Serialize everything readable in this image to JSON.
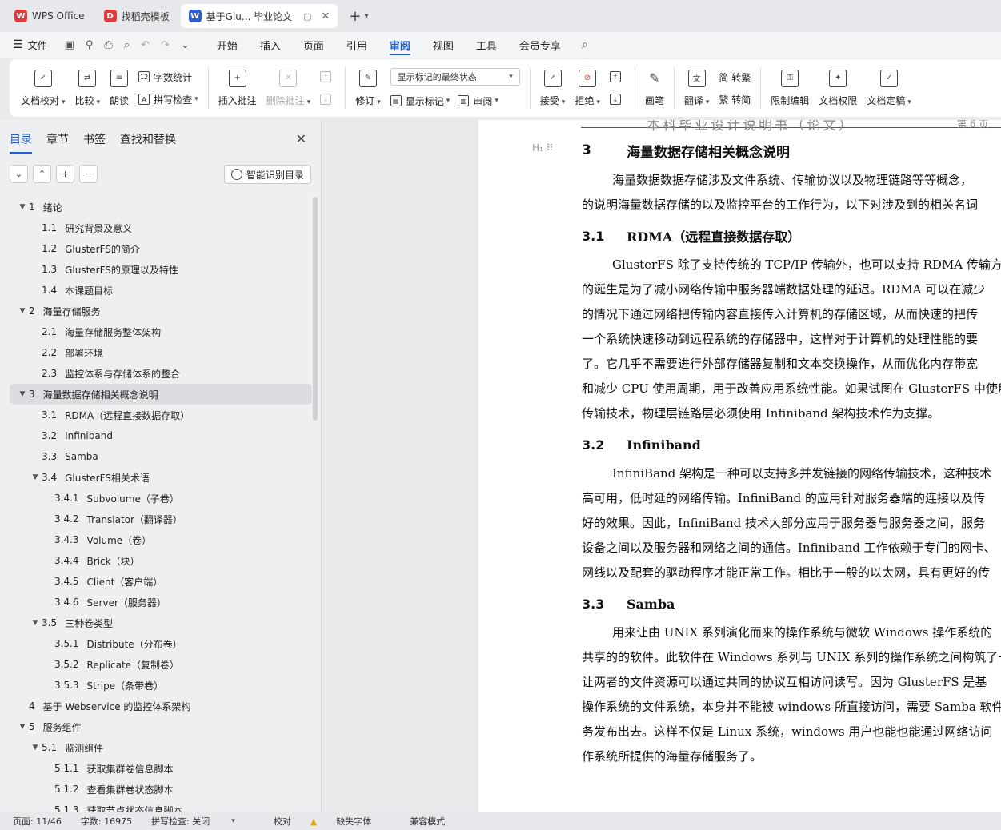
{
  "tabs": [
    {
      "label": "WPS Office",
      "logo": "W",
      "color": "#e5383b"
    },
    {
      "label": "找稻壳模板",
      "logo": "D",
      "color": "#e5383b"
    },
    {
      "label": "基于Glu... 毕业论文",
      "logo": "W",
      "color": "#2b5fd9"
    }
  ],
  "menu": {
    "file": "文件",
    "tabs": [
      "开始",
      "插入",
      "页面",
      "引用",
      "审阅",
      "视图",
      "工具",
      "会员专享"
    ],
    "active": "审阅"
  },
  "ribbon": {
    "proof": "文档校对",
    "compare": "比较",
    "read": "朗读",
    "wordcount": "字数统计",
    "spell": "拼写检查",
    "insert_comment": "插入批注",
    "delete_comment": "删除批注",
    "revise": "修订",
    "display_select": "显示标记的最终状态",
    "show_marks": "显示标记",
    "review": "审阅",
    "accept": "接受",
    "reject": "拒绝",
    "pen": "画笔",
    "translate": "翻译",
    "to_trad": "简 转繁",
    "to_simp": "繁 转简",
    "restrict": "限制编辑",
    "perm": "文档权限",
    "finalize": "文档定稿"
  },
  "nav": {
    "tabs": [
      "目录",
      "章节",
      "书签",
      "查找和替换"
    ],
    "smart_btn": "智能识别目录",
    "toc": [
      {
        "num": "1",
        "label": "绪论",
        "level": 1,
        "arrow": "▼"
      },
      {
        "num": "1.1",
        "label": "研究背景及意义",
        "level": 2,
        "arrow": ""
      },
      {
        "num": "1.2",
        "label": "GlusterFS的简介",
        "level": 2,
        "arrow": ""
      },
      {
        "num": "1.3",
        "label": "GlusterFS的原理以及特性",
        "level": 2,
        "arrow": ""
      },
      {
        "num": "1.4",
        "label": "本课题目标",
        "level": 2,
        "arrow": ""
      },
      {
        "num": "2",
        "label": "海量存储服务",
        "level": 1,
        "arrow": "▼"
      },
      {
        "num": "2.1",
        "label": "海量存储服务整体架构",
        "level": 2,
        "arrow": ""
      },
      {
        "num": "2.2",
        "label": "部署环境",
        "level": 2,
        "arrow": ""
      },
      {
        "num": "2.3",
        "label": "监控体系与存储体系的整合",
        "level": 2,
        "arrow": ""
      },
      {
        "num": "3",
        "label": "海量数据存储相关概念说明",
        "level": 1,
        "arrow": "▼",
        "selected": true
      },
      {
        "num": "3.1",
        "label": "RDMA（远程直接数据存取）",
        "level": 2,
        "arrow": ""
      },
      {
        "num": "3.2",
        "label": "Infiniband",
        "level": 2,
        "arrow": ""
      },
      {
        "num": "3.3",
        "label": "Samba",
        "level": 2,
        "arrow": ""
      },
      {
        "num": "3.4",
        "label": "GlusterFS相关术语",
        "level": 2,
        "arrow": "▼"
      },
      {
        "num": "3.4.1",
        "label": "Subvolume（子卷）",
        "level": 3,
        "arrow": ""
      },
      {
        "num": "3.4.2",
        "label": "Translator（翻译器）",
        "level": 3,
        "arrow": ""
      },
      {
        "num": "3.4.3",
        "label": "Volume（卷）",
        "level": 3,
        "arrow": ""
      },
      {
        "num": "3.4.4",
        "label": "Brick（块）",
        "level": 3,
        "arrow": ""
      },
      {
        "num": "3.4.5",
        "label": "Client（客户端）",
        "level": 3,
        "arrow": ""
      },
      {
        "num": "3.4.6",
        "label": "Server（服务器）",
        "level": 3,
        "arrow": ""
      },
      {
        "num": "3.5",
        "label": "三种卷类型",
        "level": 2,
        "arrow": "▼"
      },
      {
        "num": "3.5.1",
        "label": "Distribute（分布卷）",
        "level": 3,
        "arrow": ""
      },
      {
        "num": "3.5.2",
        "label": "Replicate（复制卷）",
        "level": 3,
        "arrow": ""
      },
      {
        "num": "3.5.3",
        "label": "Stripe（条带卷）",
        "level": 3,
        "arrow": ""
      },
      {
        "num": "4",
        "label": "基于 Webservice 的监控体系架构",
        "level": 1,
        "arrow": ""
      },
      {
        "num": "5",
        "label": "服务组件",
        "level": 1,
        "arrow": "▼"
      },
      {
        "num": "5.1",
        "label": "监测组件",
        "level": 2,
        "arrow": "▼"
      },
      {
        "num": "5.1.1",
        "label": "获取集群卷信息脚本",
        "level": 3,
        "arrow": ""
      },
      {
        "num": "5.1.2",
        "label": "查看集群卷状态脚本",
        "level": 3,
        "arrow": ""
      },
      {
        "num": "5.1.3",
        "label": "获取节点状态信息脚本",
        "level": 3,
        "arrow": ""
      }
    ]
  },
  "doc": {
    "header_title": "本科毕业设计说明书（论文）",
    "header_page": "第 6 页",
    "h1_num": "3",
    "h1_title": "海量数据存储相关概念说明",
    "intro": [
      "海量数据数据存储涉及文件系统、传输协议以及物理链路等等概念，",
      "的说明海量数据存储的以及监控平台的工作行为，以下对涉及到的相关名词"
    ],
    "s1_num": "3.1",
    "s1_title": "RDMA（远程直接数据存取）",
    "s1_lines": [
      "GlusterFS 除了支持传统的 TCP/IP 传输外，也可以支持 RDMA 传输方式",
      "的诞生是为了减小网络传输中服务器端数据处理的延迟。RDMA 可以在减少",
      "的情况下通过网络把传输内容直接传入计算机的存储区域，从而快速的把传",
      "一个系统快速移动到远程系统的存储器中，这样对于计算机的处理性能的要",
      "了。它几乎不需要进行外部存储器复制和文本交换操作，从而优化内存带宽",
      "和减少 CPU 使用周期，用于改善应用系统性能。如果试图在 GlusterFS 中使用",
      "传输技术，物理层链路层必须使用 Infiniband 架构技术作为支撑。"
    ],
    "s2_num": "3.2",
    "s2_title": "Infiniband",
    "s2_lines": [
      "InfiniBand 架构是一种可以支持多并发链接的网络传输技术，这种技术",
      "高可用，低时延的网络传输。InfiniBand 的应用针对服务器端的连接以及传",
      "好的效果。因此，InfiniBand 技术大部分应用于服务器与服务器之间，服务",
      "设备之间以及服务器和网络之间的通信。Infiniband 工作依赖于专门的网卡、",
      "网线以及配套的驱动程序才能正常工作。相比于一般的以太网，具有更好的传"
    ],
    "s3_num": "3.3",
    "s3_title": "Samba",
    "s3_lines": [
      "用来让由 UNIX 系列演化而来的操作系统与微软 Windows 操作系统的",
      "共享的的软件。此软件在 Windows 系列与 UNIX 系列的操作系统之间构筑了一",
      "让两者的文件资源可以通过共同的协议互相访问读写。因为 GlusterFS 是基",
      "操作系统的文件系统，本身并不能被 windows 所直接访问，需要 Samba 软件",
      "务发布出去。这样不仅是 Linux 系统，windows 用户也能也能通过网络访问",
      "作系统所提供的海量存储服务了。"
    ]
  },
  "status": {
    "page": "页面: 11/46",
    "words": "字数: 16975",
    "spell": "拼写检查: 关闭",
    "proof": "校对",
    "missing_font": "缺失字体",
    "compat": "兼容模式"
  }
}
